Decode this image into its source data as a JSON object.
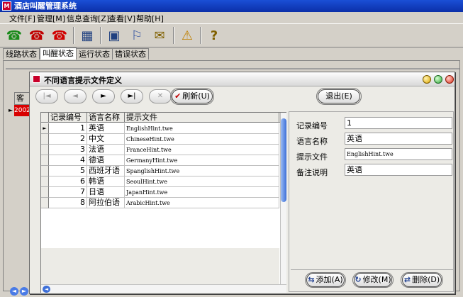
{
  "app": {
    "title": "酒店叫醒管理系统",
    "icon_text": "M"
  },
  "menu": [
    {
      "label": "文件[F]"
    },
    {
      "label": "管理[M]"
    },
    {
      "label": "信息查询[Z]"
    },
    {
      "label": "查看[V]"
    },
    {
      "label": "帮助[H]"
    }
  ],
  "toolbar": [
    {
      "icon": "phone-green-icon",
      "glyph": "☎",
      "color": "#1a8a1a"
    },
    {
      "icon": "phone-user-icon",
      "glyph": "☎",
      "color": "#c00000"
    },
    {
      "icon": "phone-red-icon",
      "glyph": "☎",
      "color": "#d00000"
    },
    {
      "icon": "network-icon",
      "glyph": "▦",
      "color": "#204080"
    },
    {
      "icon": "network-config-icon",
      "glyph": "▣",
      "color": "#204080"
    },
    {
      "icon": "flags-icon",
      "glyph": "⚐",
      "color": "#3050a0"
    },
    {
      "icon": "mail-icon",
      "glyph": "✉",
      "color": "#806000"
    },
    {
      "icon": "warning-icon",
      "glyph": "⚠",
      "color": "#c08000"
    },
    {
      "icon": "help-icon",
      "glyph": "?",
      "color": "#806000"
    }
  ],
  "tabs": [
    {
      "label": "线路状态"
    },
    {
      "label": "叫醒状态"
    },
    {
      "label": "运行状态"
    },
    {
      "label": "错误状态"
    }
  ],
  "background": {
    "grid_header": "客人",
    "grid_cell": "2002"
  },
  "dialog": {
    "title": "不同语言提示文件定义",
    "nav": {
      "first": "|◄",
      "prev": "◄",
      "next": "►",
      "last": "►|",
      "delete": "✕"
    },
    "refresh_label": "刷新(U)",
    "exit_label": "退出(E)",
    "columns": [
      "记录编号",
      "语言名称",
      "提示文件"
    ],
    "rows": [
      {
        "id": "1",
        "name": "英语",
        "file": "EnglishHint.twe"
      },
      {
        "id": "2",
        "name": "中文",
        "file": "ChineseHint.twe"
      },
      {
        "id": "3",
        "name": "法语",
        "file": "FranceHint.twe"
      },
      {
        "id": "4",
        "name": "德语",
        "file": "GermanyHint.twe"
      },
      {
        "id": "5",
        "name": "西班牙语",
        "file": "SpanglishHint.twe"
      },
      {
        "id": "6",
        "name": "韩语",
        "file": "SeoulHint.twe"
      },
      {
        "id": "7",
        "name": "日语",
        "file": "JapanHint.twe"
      },
      {
        "id": "8",
        "name": "阿拉伯语",
        "file": "ArabicHint.twe"
      }
    ],
    "form": {
      "id_label": "记录编号",
      "id_value": "1",
      "name_label": "语言名称",
      "name_value": "英语",
      "file_label": "提示文件",
      "file_value": "EnglishHint.twe",
      "note_label": "备注说明",
      "note_value": "英语"
    },
    "add_label": "添加(A)",
    "edit_label": "修改(M)",
    "remove_label": "删除(D)"
  }
}
